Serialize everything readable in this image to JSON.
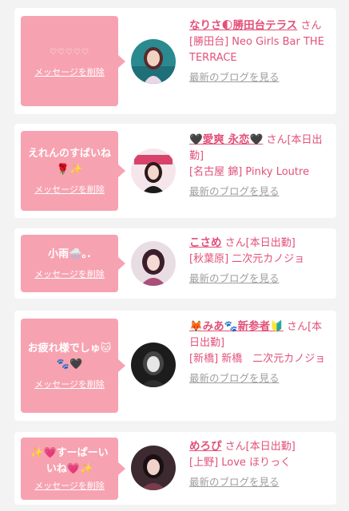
{
  "delete_label": "メッセージを削除",
  "blog_label": "最新のブログを見る",
  "cards": [
    {
      "message": "♡♡♡♡♡",
      "name": "なりさ🌓勝田台テラス",
      "san": "さん",
      "place": "[勝田台] Neo Girls Bar THE TERRACE"
    },
    {
      "message": "えれんのすばいね🌹✨",
      "name": "🖤愛爽 永恋🖤",
      "san": "さん[本日出勤]",
      "place": "[名古屋 錦] Pinky Loutre"
    },
    {
      "message": "小雨🌧️｡.",
      "name": "こさめ",
      "san": "さん[本日出勤]",
      "place": "[秋葉原] 二次元カノジョ"
    },
    {
      "message": "お疲れ様でしゅ🐱🐾🖤",
      "name": "🦊みあ🐾新参者🔰",
      "san": "さん[本日出勤]",
      "place": "[新橋] 新橋　二次元カノジョ"
    },
    {
      "message": "✨💗すーぱーいいね💗✨",
      "name": "めろぴ",
      "san": "さん[本日出勤]",
      "place": "[上野] Love ほりっく"
    }
  ],
  "colors": {
    "bubble": "#f7a2b1",
    "accent": "#e2517a",
    "muted": "#9e9e9e",
    "background": "#f3f3f3"
  }
}
